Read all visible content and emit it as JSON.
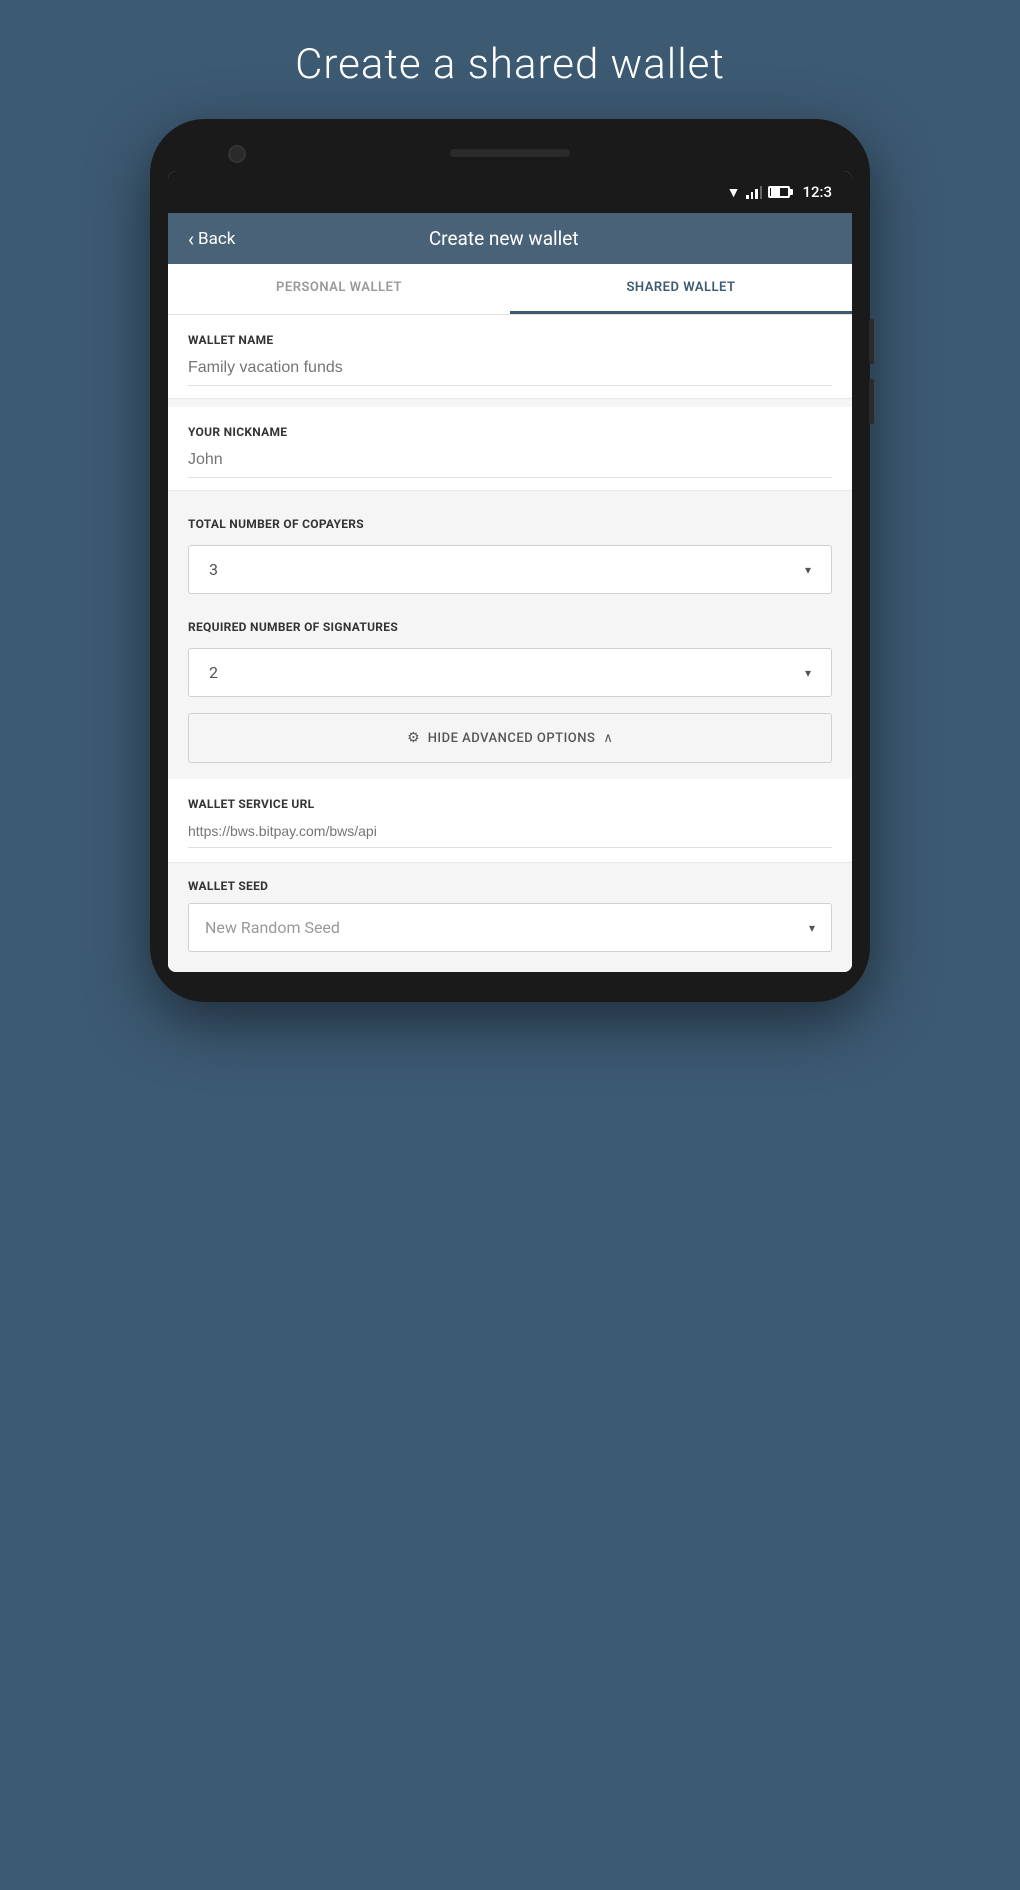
{
  "page": {
    "title": "Create a shared wallet"
  },
  "statusBar": {
    "time": "12:3"
  },
  "header": {
    "backLabel": "Back",
    "title": "Create new wallet"
  },
  "tabs": {
    "personal": "PERSONAL WALLET",
    "shared": "SHARED WALLET"
  },
  "form": {
    "walletName": {
      "label": "WALLET NAME",
      "placeholder": "Family vacation funds"
    },
    "nickname": {
      "label": "YOUR NICKNAME",
      "placeholder": "John"
    },
    "totalCopayers": {
      "label": "TOTAL NUMBER OF COPAYERS",
      "value": "3"
    },
    "requiredSignatures": {
      "label": "REQUIRED NUMBER OF SIGNATURES",
      "value": "2"
    },
    "advancedBtn": {
      "gearIcon": "⚙",
      "label": "HIDE ADVANCED OPTIONS",
      "chevron": "∧"
    },
    "walletServiceUrl": {
      "label": "WALLET SERVICE URL",
      "placeholder": "https://bws.bitpay.com/bws/api"
    },
    "walletSeed": {
      "label": "WALLET SEED",
      "value": "New Random Seed"
    }
  }
}
